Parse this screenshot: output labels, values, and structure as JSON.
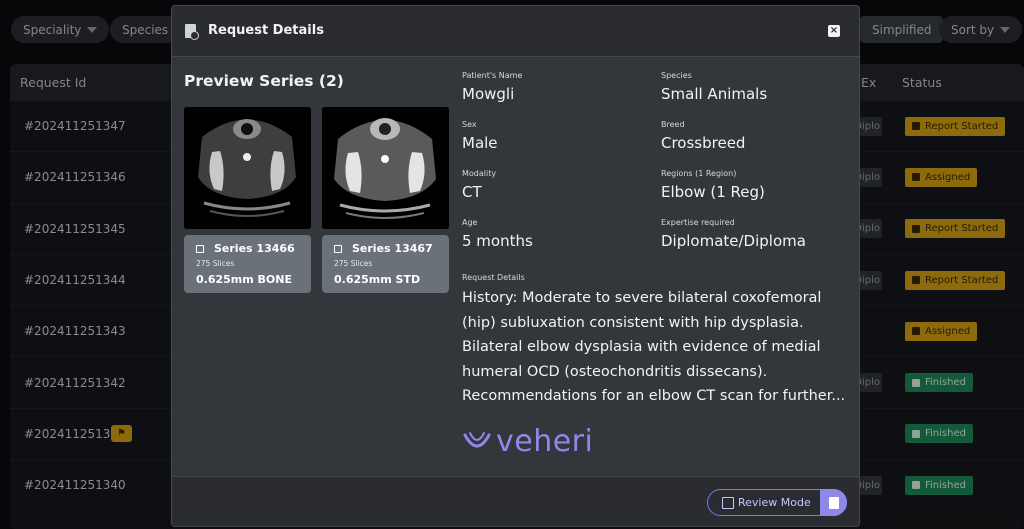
{
  "filters": {
    "speciality": "Speciality",
    "species": "Species T",
    "simplified": "Simplified",
    "sort_by": "Sort by"
  },
  "table": {
    "col_request_id": "Request Id",
    "col_ex": "Ex",
    "col_status": "Status",
    "rows": [
      {
        "id": "#202411251347",
        "ex": "Diplo",
        "status": "Report Started",
        "kind": "yellow",
        "flag": false
      },
      {
        "id": "#202411251346",
        "ex": "Diplo",
        "status": "Assigned",
        "kind": "yellow",
        "flag": false
      },
      {
        "id": "#202411251345",
        "ex": "Diplo",
        "status": "Report Started",
        "kind": "yellow",
        "flag": false
      },
      {
        "id": "#202411251344",
        "ex": "Diplo",
        "status": "Report Started",
        "kind": "yellow",
        "flag": false
      },
      {
        "id": "#202411251343",
        "ex": "",
        "status": "Assigned",
        "kind": "yellow",
        "flag": false
      },
      {
        "id": "#202411251342",
        "ex": "Diplo",
        "status": "Finished",
        "kind": "green",
        "flag": false
      },
      {
        "id": "#202411251341",
        "ex": "",
        "status": "Finished",
        "kind": "green",
        "flag": true
      },
      {
        "id": "#202411251340",
        "ex": "Diplo",
        "status": "Finished",
        "kind": "green",
        "flag": false
      }
    ]
  },
  "modal": {
    "title": "Request Details",
    "preview_title": "Preview Series (2)",
    "series": [
      {
        "name": "Series 13466",
        "slices": "275 Slices",
        "desc": "0.625mm BONE"
      },
      {
        "name": "Series 13467",
        "slices": "275 Slices",
        "desc": "0.625mm STD"
      }
    ],
    "fields": {
      "patient_label": "Patient's Name",
      "patient": "Mowgli",
      "species_label": "Species",
      "species": "Small Animals",
      "sex_label": "Sex",
      "sex": "Male",
      "breed_label": "Breed",
      "breed": "Crossbreed",
      "modality_label": "Modality",
      "modality": "CT",
      "regions_label": "Regions (1 Region)",
      "regions": "Elbow (1 Reg)",
      "age_label": "Age",
      "age": "5 months",
      "expertise_label": "Expertise required",
      "expertise": "Diplomate/Diploma",
      "details_label": "Request Details",
      "details": "History: Moderate to severe bilateral coxofemoral (hip) subluxation consistent with hip dysplasia. Bilateral elbow dysplasia with evidence of medial humeral OCD (osteochondritis dissecans). Recommendations for an elbow CT scan for further..."
    },
    "logo_text": "veheri",
    "review_label": "Review Mode"
  },
  "colors": {
    "accent": "#8e89e9",
    "yellow": "#d9a514",
    "green": "#1e8a5a"
  }
}
